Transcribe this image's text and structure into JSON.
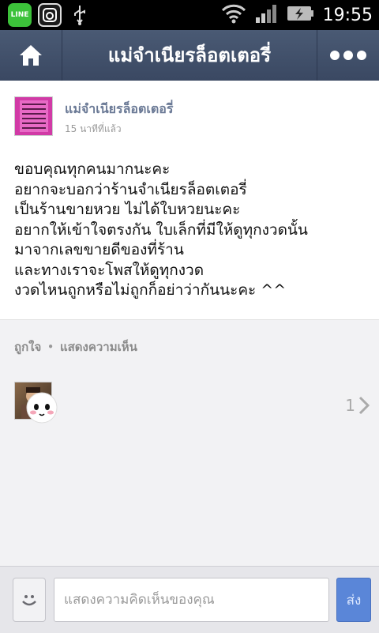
{
  "statusbar": {
    "time": "19:55",
    "line_app_label": "LINE",
    "icons": [
      "line-icon",
      "instagram-icon",
      "usb-icon",
      "wifi-icon",
      "signal-icon",
      "battery-charging-icon"
    ]
  },
  "header": {
    "title": "แม่จำเนียรล็อตเตอรี่",
    "home_icon": "home-icon",
    "more_icon": "more-dots-icon"
  },
  "post": {
    "author": "แม่จำเนียรล็อตเตอรี่",
    "time_ago": "15 นาทีที่แล้ว",
    "lines": [
      "ขอบคุณทุกคนมากนะคะ",
      "อยากจะบอกว่าร้านจำเนียรล็อตเตอรี่",
      "เป็นร้านขายหวย ไม่ได้ใบหวยนะคะ",
      "อยากให้เข้าใจตรงกัน ใบเล็กที่มีให้ดูทุกงวดนั้น",
      "มาจากเลขขายดีของที่ร้าน",
      "และทางเราจะโพสให้ดูทุกงวด",
      "งวดไหนถูกหรือไม่ถูกก็อย่าว่ากันนะคะ ^^"
    ]
  },
  "actions": {
    "like_label": "ถูกใจ",
    "separator": "•",
    "comment_label": "แสดงความเห็น"
  },
  "likes": {
    "count": "1"
  },
  "composer": {
    "placeholder": "แสดงความคิดเห็นของคุณ",
    "send_label": "ส่ง"
  },
  "colors": {
    "header_bg": "#3f4e6a",
    "author_link": "#6b7a96",
    "send_button": "#5a86d8",
    "line_green": "#3cc23a"
  }
}
